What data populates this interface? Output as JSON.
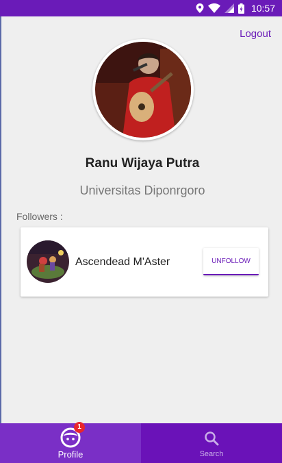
{
  "status_bar": {
    "time": "10:57",
    "background": "#6a1bb8",
    "icons": [
      "location-icon",
      "wifi-icon",
      "signal-icon",
      "battery-icon"
    ]
  },
  "header": {
    "logout_label": "Logout"
  },
  "profile": {
    "name": "Ranu Wijaya Putra",
    "school": "Universitas Diponrgoro",
    "avatar": "profile-photo"
  },
  "followers": {
    "label": "Followers :",
    "items": [
      {
        "name": "Ascendead M'Aster",
        "action_label": "UNFOLLOW",
        "avatar": "follower-photo"
      }
    ]
  },
  "bottom_nav": {
    "items": [
      {
        "label": "Profile",
        "icon": "profile-face-icon",
        "active": true,
        "badge": "1"
      },
      {
        "label": "Search",
        "icon": "search-icon",
        "active": false
      }
    ]
  },
  "colors": {
    "accent": "#6a1bb8",
    "nav_background": "#6a12b8",
    "badge": "#e8262c"
  }
}
